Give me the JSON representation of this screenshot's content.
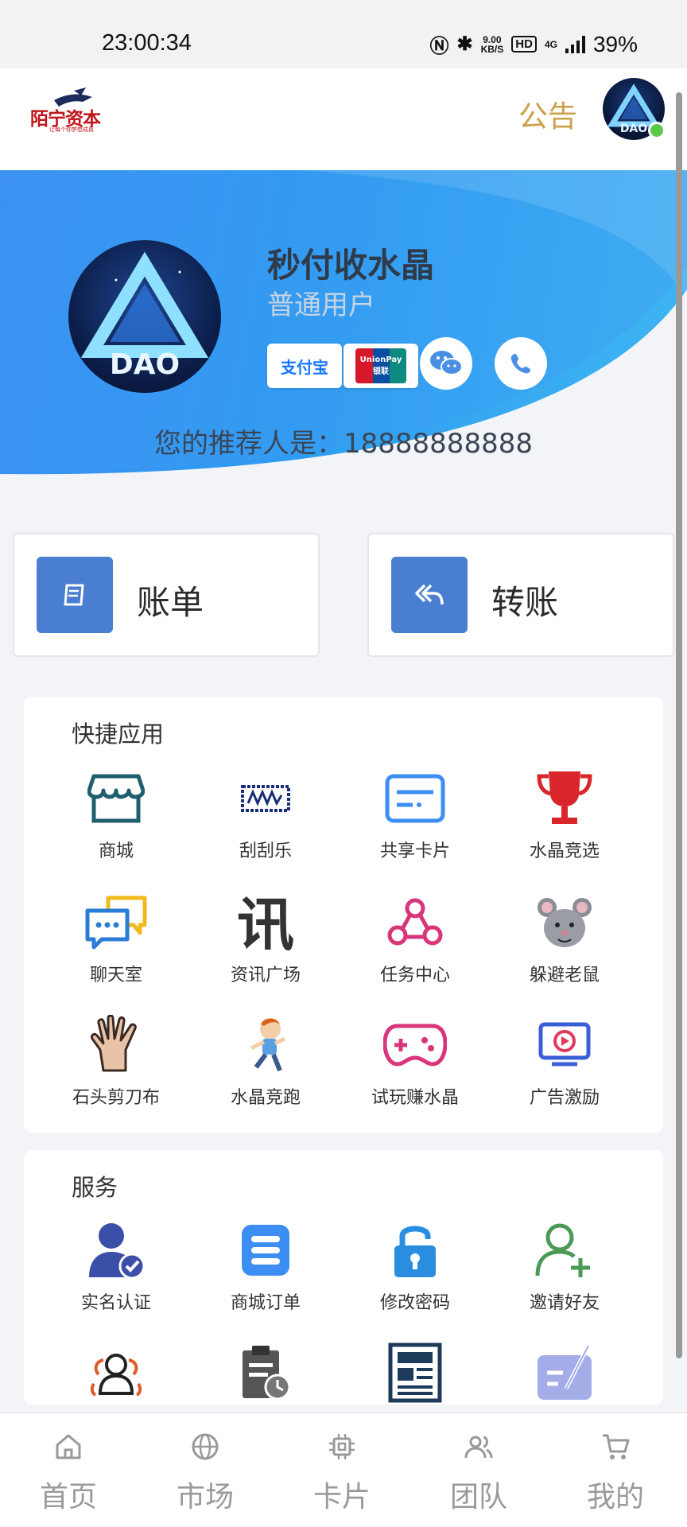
{
  "status_bar": {
    "time": "23:00:34",
    "net_speed_value": "9.00",
    "net_speed_unit": "KB/S",
    "hd": "HD",
    "network": "4G",
    "battery": "39%"
  },
  "header": {
    "logo_text": "陌宁资本",
    "logo_subtext": "让每个你梦想成真",
    "notice_label": "公告"
  },
  "profile": {
    "name": "秒付收水晶",
    "role": "普通用户",
    "alipay_label": "支付宝",
    "unionpay_label_en": "UnionPay",
    "unionpay_label_cn": "银联",
    "referrer_text": "您的推荐人是：18888888888"
  },
  "actions": {
    "bill_label": "账单",
    "transfer_label": "转账"
  },
  "quick_apps": {
    "title": "快捷应用",
    "items": [
      {
        "label": "商城",
        "icon": "store-icon"
      },
      {
        "label": "刮刮乐",
        "icon": "scratch-card-icon"
      },
      {
        "label": "共享卡片",
        "icon": "shared-card-icon"
      },
      {
        "label": "水晶竞选",
        "icon": "trophy-icon"
      },
      {
        "label": "聊天室",
        "icon": "chat-icon"
      },
      {
        "label": "资讯广场",
        "icon": "news-icon"
      },
      {
        "label": "任务中心",
        "icon": "task-icon"
      },
      {
        "label": "躲避老鼠",
        "icon": "mouse-icon"
      },
      {
        "label": "石头剪刀布",
        "icon": "hand-icon"
      },
      {
        "label": "水晶竞跑",
        "icon": "runner-icon"
      },
      {
        "label": "试玩赚水晶",
        "icon": "gamepad-icon"
      },
      {
        "label": "广告激励",
        "icon": "video-ad-icon"
      }
    ]
  },
  "services": {
    "title": "服务",
    "items": [
      {
        "label": "实名认证",
        "icon": "verified-user-icon"
      },
      {
        "label": "商城订单",
        "icon": "order-list-icon"
      },
      {
        "label": "修改密码",
        "icon": "lock-icon"
      },
      {
        "label": "邀请好友",
        "icon": "add-friend-icon"
      },
      {
        "label": "",
        "icon": "team-icon"
      },
      {
        "label": "",
        "icon": "clipboard-clock-icon"
      },
      {
        "label": "",
        "icon": "newspaper-icon"
      },
      {
        "label": "",
        "icon": "edit-note-icon"
      }
    ]
  },
  "bottom_nav": [
    {
      "label": "首页",
      "icon": "home-icon"
    },
    {
      "label": "市场",
      "icon": "globe-icon"
    },
    {
      "label": "卡片",
      "icon": "chip-icon"
    },
    {
      "label": "团队",
      "icon": "team-nav-icon"
    },
    {
      "label": "我的",
      "icon": "cart-icon"
    }
  ],
  "colors": {
    "accent_blue": "#4a7ed0",
    "notice_gold": "#c9a24a",
    "banner_blue": "#3c8ef2"
  }
}
